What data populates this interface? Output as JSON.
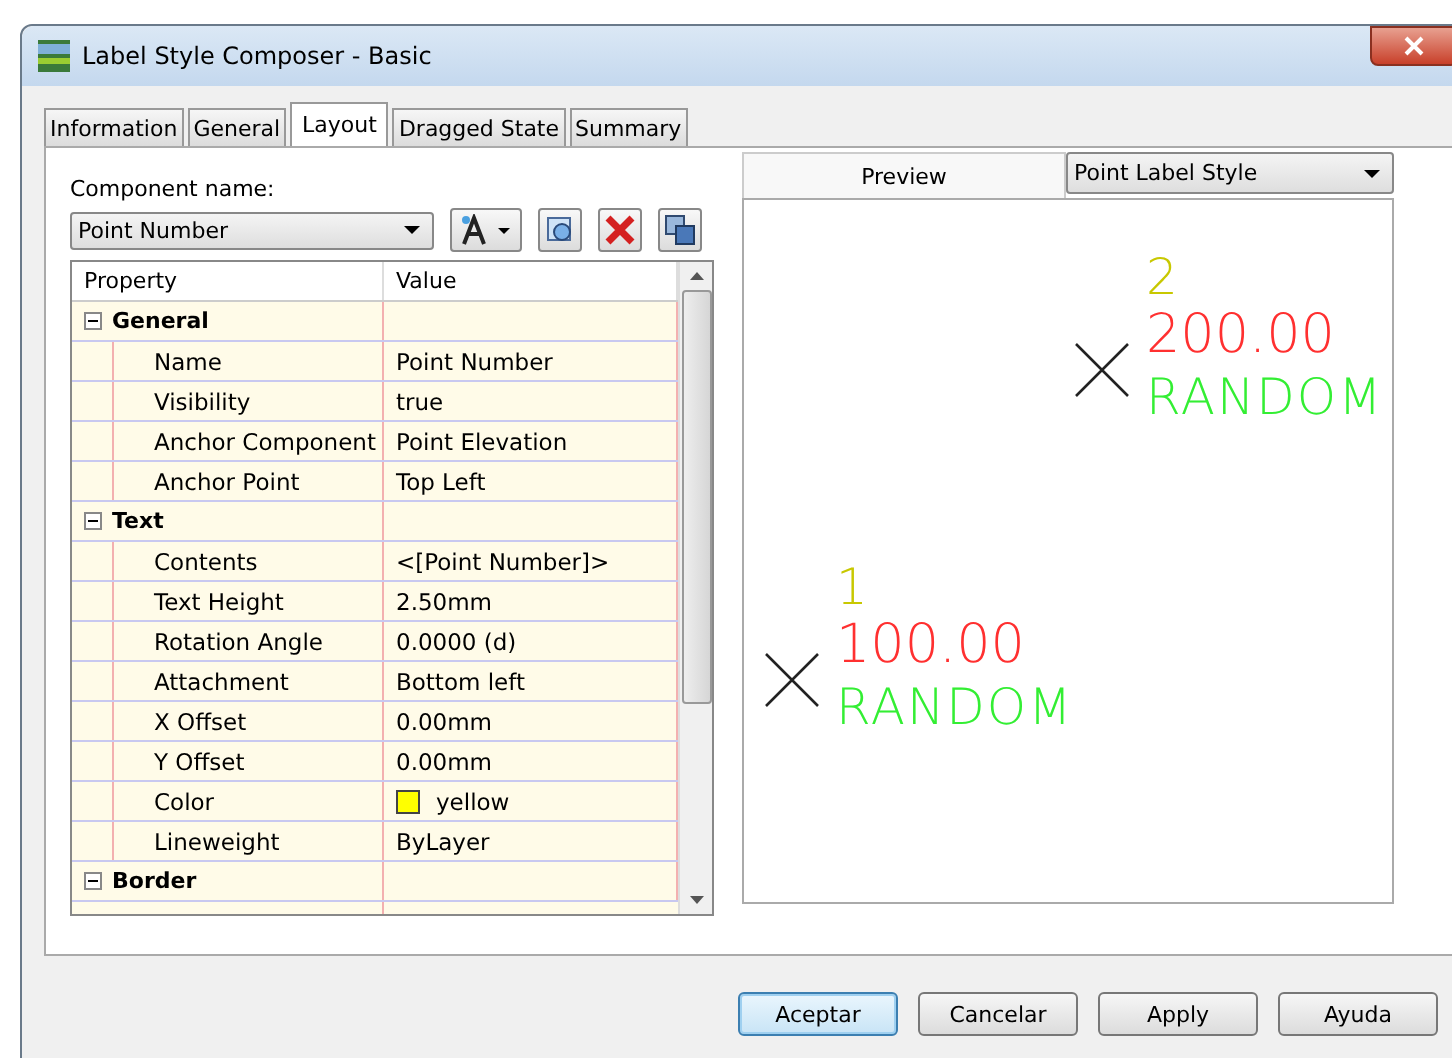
{
  "window": {
    "title": "Label Style Composer - Basic"
  },
  "tabs": [
    {
      "label": "Information",
      "selected": false
    },
    {
      "label": "General",
      "selected": false
    },
    {
      "label": "Layout",
      "selected": true
    },
    {
      "label": "Dragged State",
      "selected": false
    },
    {
      "label": "Summary",
      "selected": false
    }
  ],
  "component_name": {
    "label": "Component name:",
    "value": "Point Number"
  },
  "property_grid": {
    "columns": [
      "Property",
      "Value"
    ],
    "groups": [
      {
        "name": "General",
        "expanded": true,
        "rows": [
          {
            "property": "Name",
            "value": "Point Number"
          },
          {
            "property": "Visibility",
            "value": "true"
          },
          {
            "property": "Anchor Component",
            "value": "Point Elevation"
          },
          {
            "property": "Anchor Point",
            "value": "Top Left"
          }
        ]
      },
      {
        "name": "Text",
        "expanded": true,
        "rows": [
          {
            "property": "Contents",
            "value": "<[Point Number]>"
          },
          {
            "property": "Text Height",
            "value": "2.50mm"
          },
          {
            "property": "Rotation Angle",
            "value": "0.0000 (d)"
          },
          {
            "property": "Attachment",
            "value": "Bottom left"
          },
          {
            "property": "X Offset",
            "value": "0.00mm"
          },
          {
            "property": "Y Offset",
            "value": "0.00mm"
          },
          {
            "property": "Color",
            "value": "yellow",
            "color": "#ffff00"
          },
          {
            "property": "Lineweight",
            "value": "ByLayer"
          }
        ]
      },
      {
        "name": "Border",
        "expanded": true
      }
    ]
  },
  "preview": {
    "label": "Preview",
    "style": "Point Label Style",
    "points": [
      {
        "number": "2",
        "elevation": "200.00",
        "description": "RANDOM"
      },
      {
        "number": "1",
        "elevation": "100.00",
        "description": "RANDOM"
      }
    ]
  },
  "buttons": [
    {
      "label": "Aceptar",
      "default": true
    },
    {
      "label": "Cancelar",
      "default": false
    },
    {
      "label": "Apply",
      "default": false
    },
    {
      "label": "Ayuda",
      "default": false
    }
  ]
}
